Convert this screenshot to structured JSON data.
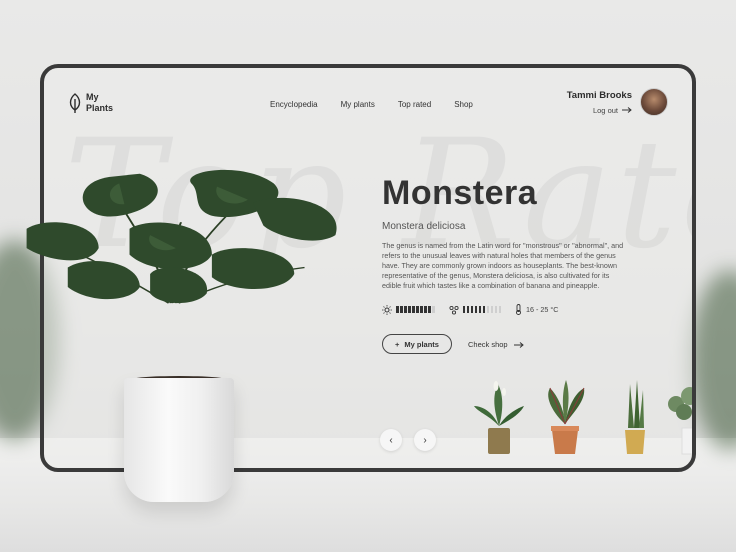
{
  "brand": {
    "logo_icon": "leaf-icon",
    "name_line1": "My",
    "name_line2": "Plants"
  },
  "nav": {
    "items": [
      "Encyclopedia",
      "My plants",
      "Top rated",
      "Shop"
    ]
  },
  "user": {
    "name": "Tammi Brooks",
    "logout_label": "Log out",
    "avatar_icon": "avatar"
  },
  "background_script": "Top Rated",
  "plant": {
    "name": "Monstera",
    "latin": "Monstera deliciosa",
    "description": "The genus is named from the Latin word for \"monstrous\" or \"abnormal\", and refers to the unusual leaves with natural holes that members of the genus have. They are commonly grown indoors as houseplants. The best-known representative of the genus, Monstera deliciosa, is also cultivated for its edible fruit which tastes like a combination of banana and pineapple.",
    "sunlight_level": 0.9,
    "water_level": 0.6,
    "temperature": "16 - 25 °C"
  },
  "actions": {
    "add_label": "My plants",
    "add_icon": "plus-icon",
    "shop_label": "Check shop",
    "shop_icon": "arrow-right-icon"
  },
  "carousel": {
    "prev_icon": "chevron-left-icon",
    "next_icon": "chevron-right-icon"
  },
  "colors": {
    "accent": "#333333",
    "frame": "#3a3a3a",
    "leaf": "#2f4a2c"
  }
}
